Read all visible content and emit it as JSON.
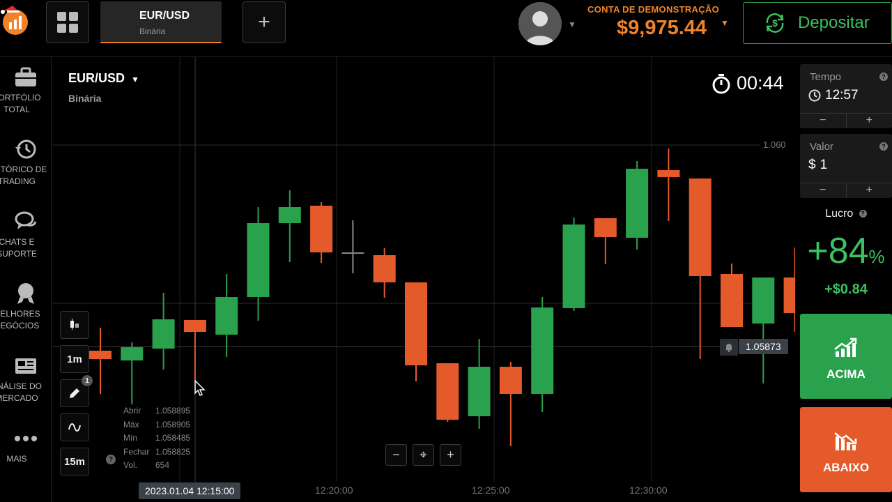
{
  "header": {
    "asset_tab": {
      "name": "EUR/USD",
      "type": "Binária"
    },
    "add_tab_label": "+",
    "account_label": "CONTA DE DEMONSTRAÇÃO",
    "balance": "$9,975.44",
    "deposit_label": "Depositar"
  },
  "sidebar": {
    "items": [
      {
        "label": "PORTFÓLIO\nTOTAL",
        "icon": "briefcase-icon"
      },
      {
        "label": "HISTÓRICO DE\nTRADING",
        "icon": "history-icon"
      },
      {
        "label": "CHATS E\nSUPORTE",
        "icon": "chat-icon"
      },
      {
        "label": "MELHORES\nNEGÓCIOS",
        "icon": "medal-icon"
      },
      {
        "label": "ANÁLISE DO\nMERCADO",
        "icon": "newspaper-icon"
      },
      {
        "label": "MAIS",
        "icon": "more-icon"
      }
    ]
  },
  "chart": {
    "asset": "EUR/USD",
    "asset_type": "Binária",
    "countdown": "00:44",
    "current_price": "1.05873",
    "hover_date": "2023.01.04 12:15:00",
    "timeframe": "1m",
    "candle_period": "15m",
    "drawing_count": "1",
    "ohlc": [
      {
        "k": "Abrir",
        "v": "1.058895"
      },
      {
        "k": "Máx",
        "v": "1.058905"
      },
      {
        "k": "Mín",
        "v": "1.058485"
      },
      {
        "k": "Fechar",
        "v": "1.058825"
      },
      {
        "k": "Vol.",
        "v": "654"
      }
    ],
    "zoom": {
      "out": "−",
      "center": "⌖",
      "in": "+"
    }
  },
  "chart_data": {
    "type": "candlestick",
    "x_ticks": [
      "12:20:00",
      "12:25:00",
      "12:30:00"
    ],
    "y_ticks": [
      "1.060"
    ],
    "colors": {
      "up": "#2aa14d",
      "down": "#e55a2b",
      "doji": "#888888"
    },
    "candles": [
      {
        "o": 503,
        "c": 515,
        "h": 470,
        "l": 565
      },
      {
        "o": 517,
        "c": 498,
        "h": 491,
        "l": 580
      },
      {
        "o": 500,
        "c": 458,
        "h": 420,
        "l": 530
      },
      {
        "o": 459,
        "c": 476,
        "h": 459,
        "l": 545
      },
      {
        "o": 480,
        "c": 426,
        "h": 393,
        "l": 512
      },
      {
        "o": 426,
        "c": 320,
        "h": 297,
        "l": 460
      },
      {
        "o": 320,
        "c": 297,
        "h": 273,
        "l": 376
      },
      {
        "o": 295,
        "c": 362,
        "h": 290,
        "l": 377
      },
      {
        "o": 362,
        "c": 362,
        "h": 316,
        "l": 392
      },
      {
        "o": 366,
        "c": 405,
        "h": 356,
        "l": 427
      },
      {
        "o": 405,
        "c": 524,
        "h": 405,
        "l": 547
      },
      {
        "o": 521,
        "c": 602,
        "h": 521,
        "l": 605
      },
      {
        "o": 597,
        "c": 526,
        "h": 486,
        "l": 615
      },
      {
        "o": 526,
        "c": 565,
        "h": 519,
        "l": 640
      },
      {
        "o": 565,
        "c": 441,
        "h": 426,
        "l": 591
      },
      {
        "o": 442,
        "c": 322,
        "h": 312,
        "l": 446
      },
      {
        "o": 313,
        "c": 340,
        "h": 313,
        "l": 379
      },
      {
        "o": 341,
        "c": 242,
        "h": 231,
        "l": 358
      },
      {
        "o": 244,
        "c": 254,
        "h": 213,
        "l": 317
      },
      {
        "o": 256,
        "c": 396,
        "h": 256,
        "l": 515
      },
      {
        "o": 393,
        "c": 469,
        "h": 378,
        "l": 469
      },
      {
        "o": 464,
        "c": 398,
        "h": 398,
        "l": 550
      },
      {
        "o": 398,
        "c": 449,
        "h": 355,
        "l": 476
      }
    ]
  },
  "panel": {
    "time_label": "Tempo",
    "time_value": "12:57",
    "amount_label": "Valor",
    "amount_currency": "$",
    "amount_value": "1",
    "minus": "−",
    "plus": "+",
    "profit_label": "Lucro",
    "profit_percent": "+84",
    "percent_sign": "%",
    "profit_amount": "+$0.84",
    "up_label": "ACIMA",
    "down_label": "ABAIXO"
  }
}
